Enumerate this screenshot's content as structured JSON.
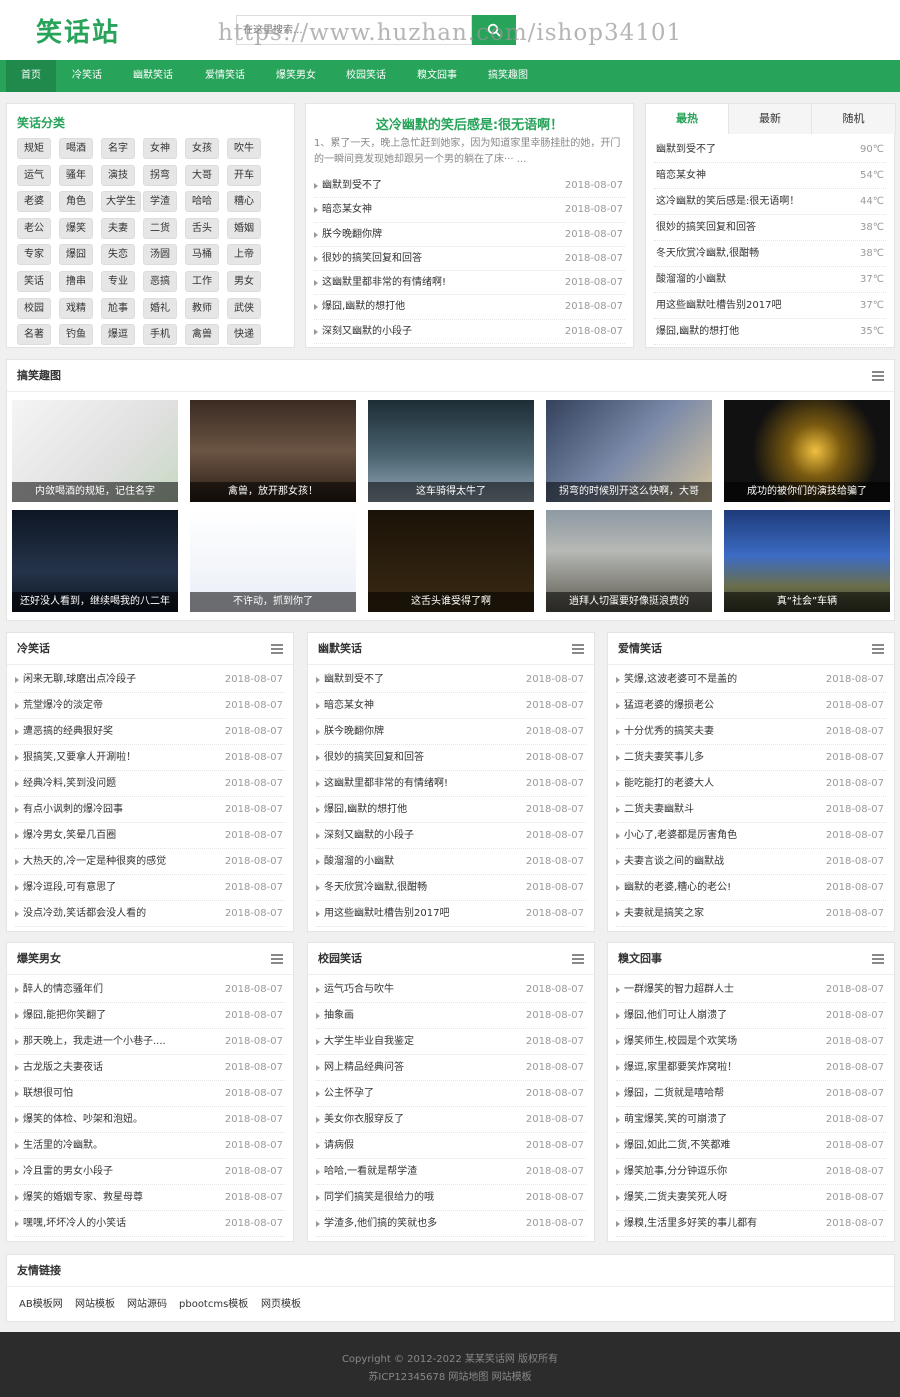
{
  "header": {
    "logo": "笑话站",
    "search_placeholder": "在这里搜索...",
    "watermark": "https://www.huzhan.com/ishop34101"
  },
  "nav": [
    "首页",
    "冷笑话",
    "幽默笑话",
    "爱情笑话",
    "爆笑男女",
    "校园笑话",
    "糗文囧事",
    "搞笑趣图"
  ],
  "categories": {
    "title": "笑话分类",
    "tags": [
      "规矩",
      "喝酒",
      "名字",
      "女神",
      "女孩",
      "吹牛",
      "运气",
      "骚年",
      "演技",
      "拐弯",
      "大哥",
      "开车",
      "老婆",
      "角色",
      "大学生",
      "学渣",
      "哈哈",
      "糟心",
      "老公",
      "爆笑",
      "夫妻",
      "二货",
      "舌头",
      "婚姻",
      "专家",
      "爆囧",
      "失恋",
      "汤圆",
      "马桶",
      "上帝",
      "笑话",
      "撸串",
      "专业",
      "恶搞",
      "工作",
      "男女",
      "校园",
      "戏精",
      "尬事",
      "婚礼",
      "教师",
      "武侠",
      "名著",
      "钓鱼",
      "爆逗",
      "手机",
      "禽兽",
      "快递"
    ]
  },
  "featured": {
    "title": "这冷幽默的笑后感是:很无语啊！",
    "desc": "1、累了一天，晚上急忙赶到她家，因为知道家里幸肠挂肚的她，开门的一瞬间竟发现她却跟另一个男的躺在了床···  ...",
    "items": [
      {
        "t": "幽默到受不了",
        "d": "2018-08-07"
      },
      {
        "t": "暗恋某女神",
        "d": "2018-08-07"
      },
      {
        "t": "朕今晚翻你牌",
        "d": "2018-08-07"
      },
      {
        "t": "很妙的搞笑回复和回答",
        "d": "2018-08-07"
      },
      {
        "t": "这幽默里都非常的有情绪啊!",
        "d": "2018-08-07"
      },
      {
        "t": "爆囧,幽默的想打他",
        "d": "2018-08-07"
      },
      {
        "t": "深刻又幽默的小段子",
        "d": "2018-08-07"
      }
    ]
  },
  "hot": {
    "tabs": [
      "最热",
      "最新",
      "随机"
    ],
    "items": [
      {
        "t": "幽默到受不了",
        "d": "90℃"
      },
      {
        "t": "暗恋某女神",
        "d": "54℃"
      },
      {
        "t": "这冷幽默的笑后感是:很无语啊！",
        "d": "44℃"
      },
      {
        "t": "很妙的搞笑回复和回答",
        "d": "38℃"
      },
      {
        "t": "冬天欣赏冷幽默,很酣畅",
        "d": "38℃"
      },
      {
        "t": "酸溜溜的小幽默",
        "d": "37℃"
      },
      {
        "t": "用这些幽默吐槽告别2017吧",
        "d": "37℃"
      },
      {
        "t": "爆囧,幽默的想打他",
        "d": "35℃"
      }
    ]
  },
  "gallery": {
    "title": "搞笑趣图",
    "items": [
      {
        "cap": "内敛喝酒的规矩，记住名字"
      },
      {
        "cap": "禽兽，放开那女孩！"
      },
      {
        "cap": "这车骑得太牛了"
      },
      {
        "cap": "拐弯的时候别开这么快啊，大哥"
      },
      {
        "cap": "成功的被你们的演技给骗了"
      },
      {
        "cap": "还好没人看到，继续喝我的八二年"
      },
      {
        "cap": "不许动，抓到你了"
      },
      {
        "cap": "这舌头谁受得了啊"
      },
      {
        "cap": "逍拜人切蛋要好像挺浪费的"
      },
      {
        "cap": "真“社会”车辆"
      }
    ]
  },
  "sections": [
    {
      "title": "冷笑话",
      "items": [
        {
          "t": "闲来无聊,球磨出点冷段子",
          "d": "2018-08-07"
        },
        {
          "t": "荒堂爆冷的淡定帝",
          "d": "2018-08-07"
        },
        {
          "t": "遭恶搞的经典狠好奖",
          "d": "2018-08-07"
        },
        {
          "t": "狠搞笑,又要拿人开涮啦！",
          "d": "2018-08-07"
        },
        {
          "t": "经典冷料,笑到没问题",
          "d": "2018-08-07"
        },
        {
          "t": "有点小讽刺的爆冷囧事",
          "d": "2018-08-07"
        },
        {
          "t": "爆冷男女,笑晕几百圈",
          "d": "2018-08-07"
        },
        {
          "t": "大热天的,冷一定是种很爽的感觉",
          "d": "2018-08-07"
        },
        {
          "t": "爆冷逗段,可有意思了",
          "d": "2018-08-07"
        },
        {
          "t": "没点冷劲,笑话都会没人看的",
          "d": "2018-08-07"
        }
      ]
    },
    {
      "title": "幽默笑话",
      "items": [
        {
          "t": "幽默到受不了",
          "d": "2018-08-07"
        },
        {
          "t": "暗恋某女神",
          "d": "2018-08-07"
        },
        {
          "t": "朕今晚翻你牌",
          "d": "2018-08-07"
        },
        {
          "t": "很妙的搞笑回复和回答",
          "d": "2018-08-07"
        },
        {
          "t": "这幽默里都非常的有情绪啊!",
          "d": "2018-08-07"
        },
        {
          "t": "爆囧,幽默的想打他",
          "d": "2018-08-07"
        },
        {
          "t": "深刻又幽默的小段子",
          "d": "2018-08-07"
        },
        {
          "t": "酸溜溜的小幽默",
          "d": "2018-08-07"
        },
        {
          "t": "冬天欣赏冷幽默,很酣畅",
          "d": "2018-08-07"
        },
        {
          "t": "用这些幽默吐槽告别2017吧",
          "d": "2018-08-07"
        }
      ]
    },
    {
      "title": "爱情笑话",
      "items": [
        {
          "t": "笑爆,这波老婆可不是盖的",
          "d": "2018-08-07"
        },
        {
          "t": "猛逗老婆的爆损老公",
          "d": "2018-08-07"
        },
        {
          "t": "十分优秀的搞笑夫妻",
          "d": "2018-08-07"
        },
        {
          "t": "二货夫妻笑事儿多",
          "d": "2018-08-07"
        },
        {
          "t": "能吃能打的老婆大人",
          "d": "2018-08-07"
        },
        {
          "t": "二货夫妻幽默斗",
          "d": "2018-08-07"
        },
        {
          "t": "小心了,老婆都是厉害角色",
          "d": "2018-08-07"
        },
        {
          "t": "夫妻言谈之间的幽默战",
          "d": "2018-08-07"
        },
        {
          "t": "幽默的老婆,糟心的老公!",
          "d": "2018-08-07"
        },
        {
          "t": "夫妻就是搞笑之家",
          "d": "2018-08-07"
        }
      ]
    },
    {
      "title": "爆笑男女",
      "items": [
        {
          "t": "醉人的情恋骚年们",
          "d": "2018-08-07"
        },
        {
          "t": "爆囧,能把你笑翻了",
          "d": "2018-08-07"
        },
        {
          "t": "那天晚上，我走进一个小巷子....",
          "d": "2018-08-07"
        },
        {
          "t": "古龙版之夫妻夜话",
          "d": "2018-08-07"
        },
        {
          "t": "联想很可怕",
          "d": "2018-08-07"
        },
        {
          "t": "爆笑的体检、吵架和泡妞。",
          "d": "2018-08-07"
        },
        {
          "t": "生活里的冷幽默。",
          "d": "2018-08-07"
        },
        {
          "t": "冷且雷的男女小段子",
          "d": "2018-08-07"
        },
        {
          "t": "爆笑的婚姻专家、救星母尊",
          "d": "2018-08-07"
        },
        {
          "t": "嘿嘿,坏坏冷人的小笑话",
          "d": "2018-08-07"
        }
      ]
    },
    {
      "title": "校园笑话",
      "items": [
        {
          "t": "运气巧合与吹牛",
          "d": "2018-08-07"
        },
        {
          "t": "抽象画",
          "d": "2018-08-07"
        },
        {
          "t": "大学生毕业自我鉴定",
          "d": "2018-08-07"
        },
        {
          "t": "网上精品经典问答",
          "d": "2018-08-07"
        },
        {
          "t": "公主怀孕了",
          "d": "2018-08-07"
        },
        {
          "t": "美女你衣服穿反了",
          "d": "2018-08-07"
        },
        {
          "t": "请病假",
          "d": "2018-08-07"
        },
        {
          "t": "哈哈,一看就是帮学渣",
          "d": "2018-08-07"
        },
        {
          "t": "同学们搞笑是很给力的哦",
          "d": "2018-08-07"
        },
        {
          "t": "学渣多,他们搞的笑就也多",
          "d": "2018-08-07"
        }
      ]
    },
    {
      "title": "糗文囧事",
      "items": [
        {
          "t": "一群爆笑的智力超群人士",
          "d": "2018-08-07"
        },
        {
          "t": "爆囧,他们可让人崩溃了",
          "d": "2018-08-07"
        },
        {
          "t": "爆笑师生,校园是个欢笑场",
          "d": "2018-08-07"
        },
        {
          "t": "爆逗,家里都要笑炸窝啦！",
          "d": "2018-08-07"
        },
        {
          "t": "爆囧，二货就是嘻哈帮",
          "d": "2018-08-07"
        },
        {
          "t": "萌宝爆笑,笑的可崩溃了",
          "d": "2018-08-07"
        },
        {
          "t": "爆囧,如此二货,不笑都难",
          "d": "2018-08-07"
        },
        {
          "t": "爆笑尬事,分分钟逗乐你",
          "d": "2018-08-07"
        },
        {
          "t": "爆笑,二货夫妻笑死人呀",
          "d": "2018-08-07"
        },
        {
          "t": "爆糗,生活里多好笑的事儿都有",
          "d": "2018-08-07"
        }
      ]
    }
  ],
  "friend_links": {
    "title": "友情链接",
    "items": [
      "AB模板网",
      "网站模板",
      "网站源码",
      "pbootcms模板",
      "网页模板"
    ]
  },
  "footer": {
    "copyright": "Copyright © 2012-2022 某某笑话网 版权所有",
    "icp": "苏ICP12345678 网站地图 网站模板"
  },
  "colors": {
    "brand": "#27a35a",
    "footer_bg": "#2c2c2c"
  }
}
